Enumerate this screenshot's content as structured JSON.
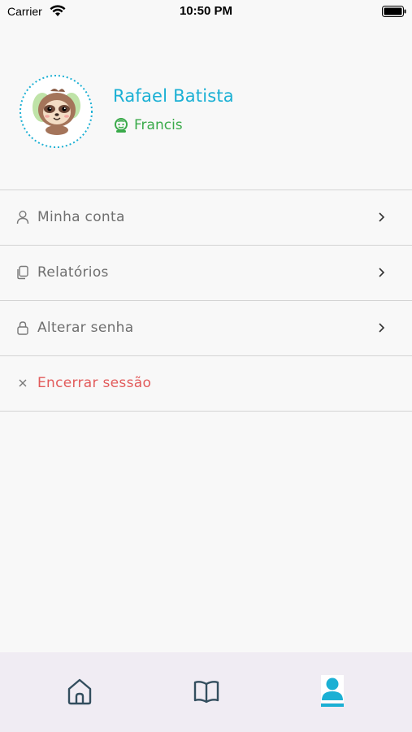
{
  "status_bar": {
    "carrier": "Carrier",
    "time": "10:50 PM"
  },
  "profile": {
    "avatar_icon": "sloth-avatar",
    "name": "Rafael Batista",
    "child_icon": "baby-face-icon",
    "child_name": "Francis"
  },
  "menu": [
    {
      "icon": "user-icon",
      "label": "Minha conta"
    },
    {
      "icon": "documents-icon",
      "label": "Relatórios"
    },
    {
      "icon": "lock-icon",
      "label": "Alterar senha"
    },
    {
      "icon": "close-icon",
      "label": "Encerrar sessão"
    }
  ],
  "tabbar": {
    "tabs": [
      "home-icon",
      "book-icon",
      "profile-icon"
    ],
    "active": "profile-icon"
  },
  "colors": {
    "accent": "#1bb0d4",
    "child_green": "#3aaa4a",
    "logout_red": "#e25b5b",
    "tabbar_bg": "#f0ecf3"
  }
}
